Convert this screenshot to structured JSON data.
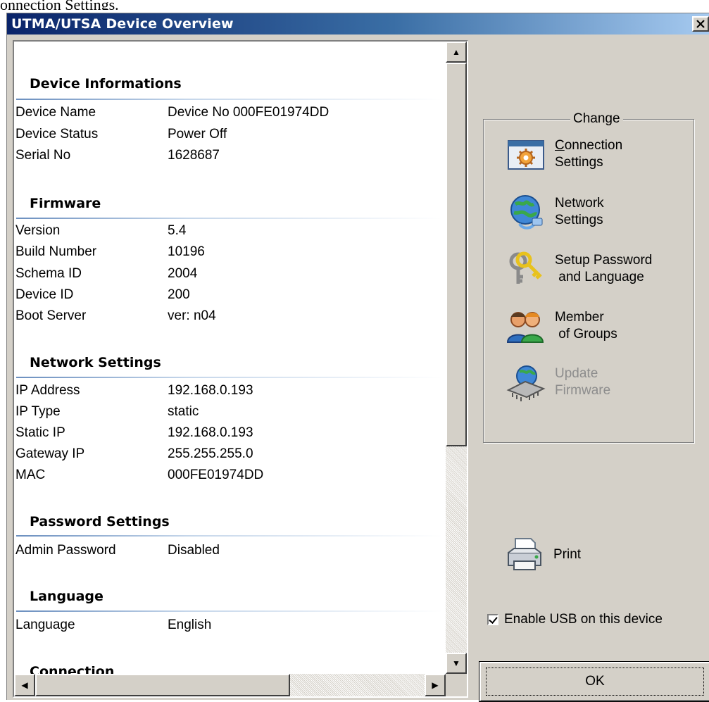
{
  "caption": "onnection Settings.",
  "window": {
    "title": "UTMA/UTSA Device Overview",
    "close_glyph": "✕"
  },
  "sections": {
    "device": {
      "title": "Device Informations",
      "rows": [
        {
          "label": "Device Name",
          "value": "Device No  000FE01974DD"
        },
        {
          "label": "Device Status",
          "value": "Power Off"
        },
        {
          "label": "Serial No",
          "value": "1628687"
        }
      ]
    },
    "firmware": {
      "title": "Firmware",
      "rows": [
        {
          "label": "Version",
          "value": "5.4"
        },
        {
          "label": "Build Number",
          "value": "10196"
        },
        {
          "label": "Schema ID",
          "value": "2004"
        },
        {
          "label": "Device ID",
          "value": "200"
        },
        {
          "label": "Boot Server",
          "value": "ver: n04"
        }
      ]
    },
    "network": {
      "title": "Network Settings",
      "rows": [
        {
          "label": "IP Address",
          "value": "192.168.0.193"
        },
        {
          "label": "IP Type",
          "value": "static"
        },
        {
          "label": "Static IP",
          "value": "192.168.0.193"
        },
        {
          "label": "Gateway IP",
          "value": "255.255.255.0"
        },
        {
          "label": "MAC",
          "value": "000FE01974DD"
        }
      ]
    },
    "password": {
      "title": "Password Settings",
      "rows": [
        {
          "label": "Admin Password",
          "value": "Disabled"
        }
      ]
    },
    "language": {
      "title": "Language",
      "rows": [
        {
          "label": "Language",
          "value": "English"
        }
      ]
    },
    "connection": {
      "title": "Connection"
    }
  },
  "change_group": {
    "title": "Change",
    "connection": {
      "mnemonic": "C",
      "line1_rest": "onnection",
      "line2": "Settings",
      "icon": "window-gear-icon"
    },
    "network": {
      "line1": "Network",
      "line2": "Settings",
      "icon": "globe-network-icon"
    },
    "password": {
      "line1": "Setup Password",
      "line2": "and Language",
      "icon": "keys-icon"
    },
    "groups": {
      "line1": "Member",
      "line2": "of Groups",
      "icon": "users-icon"
    },
    "firmware": {
      "line1": "Update",
      "line2": "Firmware",
      "icon": "chip-globe-icon",
      "enabled": false
    }
  },
  "print": {
    "label": "Print",
    "icon": "printer-icon"
  },
  "usb": {
    "label": "Enable USB on this device",
    "checked": true
  },
  "ok": {
    "label": "OK"
  },
  "scroll": {
    "up": "▲",
    "down": "▼",
    "left": "◀",
    "right": "▶"
  },
  "colors": {
    "title_gradient_start": "#0a246a",
    "title_gradient_end": "#a6caf0",
    "face": "#d4d0c8",
    "disabled_text": "#8d8d8d"
  }
}
